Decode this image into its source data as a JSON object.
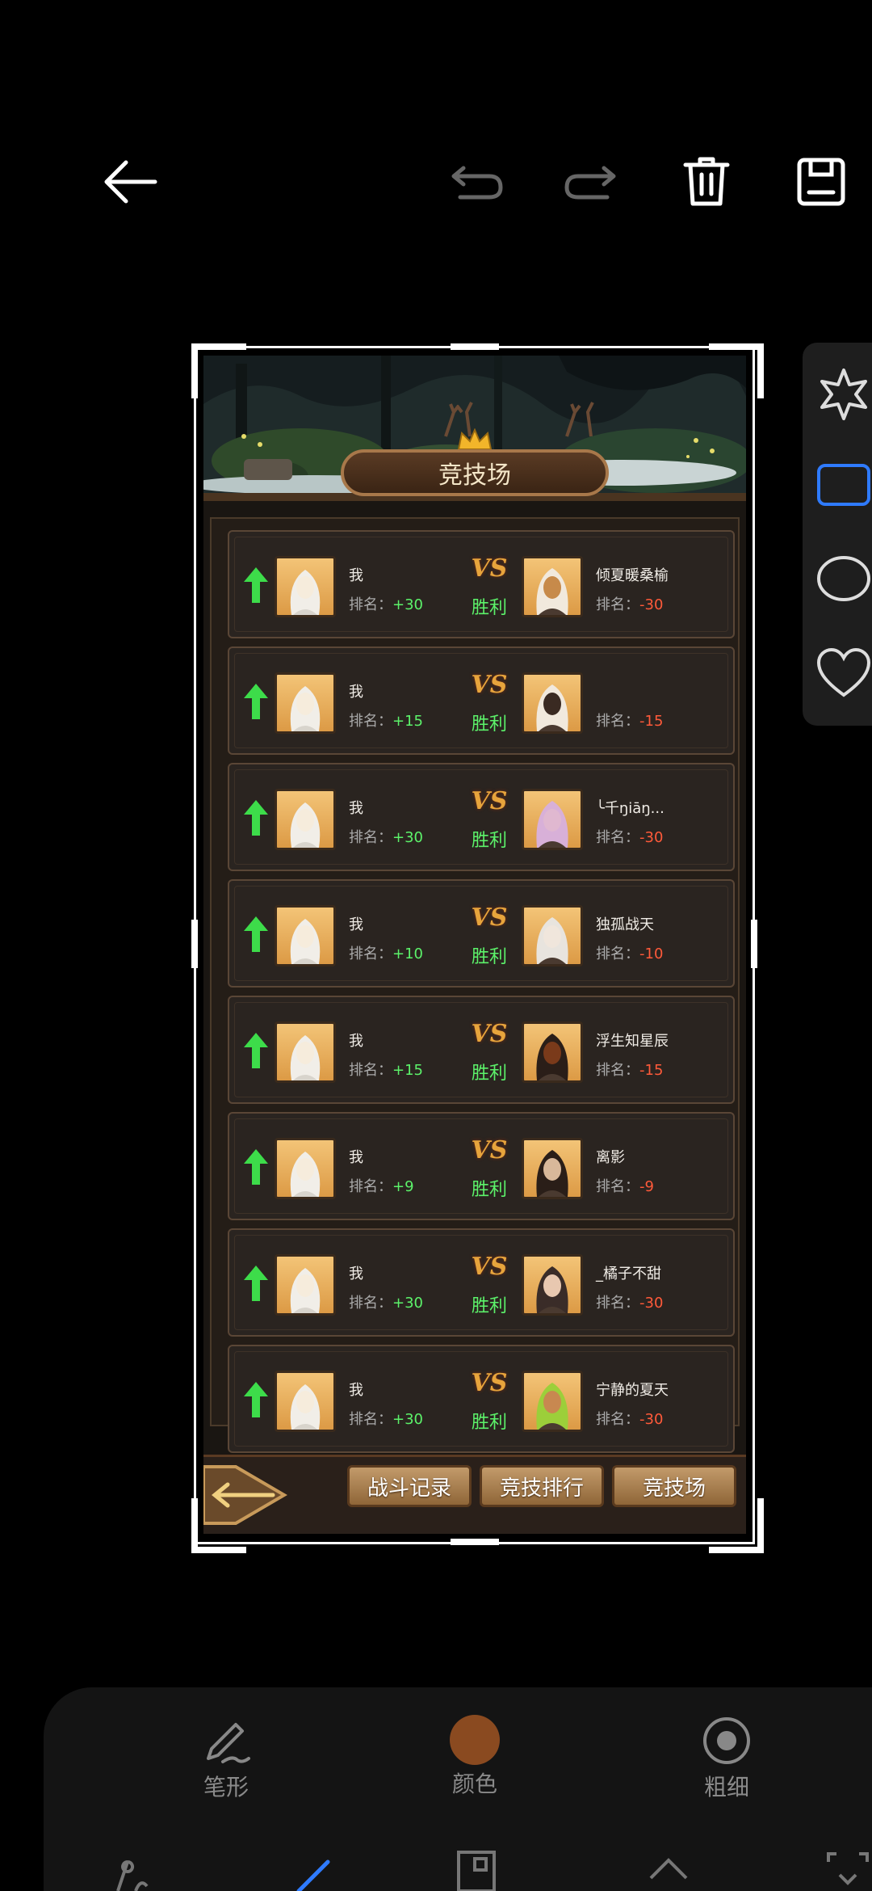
{
  "toolbar": {
    "back_icon": "back-arrow-icon",
    "undo_icon": "undo-icon",
    "redo_icon": "redo-icon",
    "delete_icon": "trash-icon",
    "save_icon": "save-icon"
  },
  "game": {
    "title": "竞技场",
    "rank_label": "排名：",
    "vs_label": "VS",
    "result_label": "胜利",
    "matches": [
      {
        "left_name": "我",
        "left_change": "+30",
        "right_name": "倾夏暖桑榆",
        "right_change": "-30"
      },
      {
        "left_name": "我",
        "left_change": "+15",
        "right_name": "",
        "right_change": "-15"
      },
      {
        "left_name": "我",
        "left_change": "+30",
        "right_name": "╰千ŋiāŋ...",
        "right_change": "-30"
      },
      {
        "left_name": "我",
        "left_change": "+10",
        "right_name": "独孤战天",
        "right_change": "-10"
      },
      {
        "left_name": "我",
        "left_change": "+15",
        "right_name": "浮生知星辰",
        "right_change": "-15"
      },
      {
        "left_name": "我",
        "left_change": "+9",
        "right_name": "离影",
        "right_change": "-9"
      },
      {
        "left_name": "我",
        "left_change": "+30",
        "right_name": "_橘子不甜",
        "right_change": "-30"
      },
      {
        "left_name": "我",
        "left_change": "+30",
        "right_name": "宁静的夏天",
        "right_change": "-30"
      }
    ],
    "tabs": {
      "battle_record": "战斗记录",
      "ranking": "竞技排行",
      "arena": "竞技场"
    }
  },
  "side_tools": [
    "star-shape-icon",
    "rectangle-shape-icon",
    "circle-shape-icon",
    "heart-shape-icon"
  ],
  "editor": {
    "pen_label": "笔形",
    "color_label": "颜色",
    "color_value": "#8a4a20",
    "thickness_label": "粗细"
  }
}
